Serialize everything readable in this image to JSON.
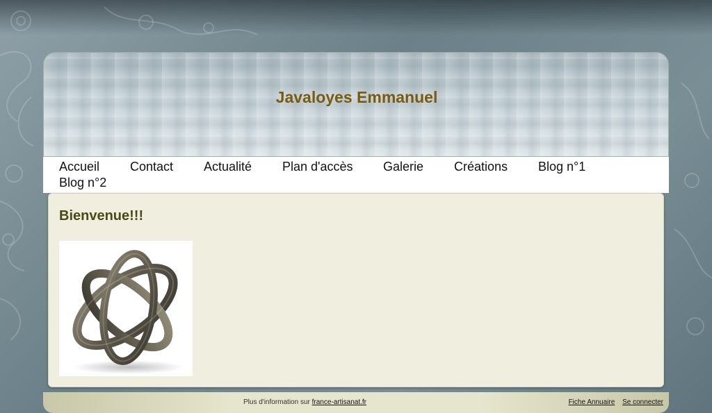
{
  "site": {
    "title": "Javaloyes Emmanuel"
  },
  "nav": {
    "items": [
      {
        "label": "Accueil"
      },
      {
        "label": "Contact"
      },
      {
        "label": "Actualité"
      },
      {
        "label": "Plan d'accès"
      },
      {
        "label": "Galerie"
      },
      {
        "label": "Créations"
      },
      {
        "label": "Blog n°1"
      },
      {
        "label": "Blog n°2"
      }
    ]
  },
  "main": {
    "heading": "Bienvenue!!!",
    "image": {
      "alt": "sculpture métallique entrelacée",
      "icon": "metal-ring-sculpture"
    }
  },
  "footer": {
    "info_prefix": "Plus d'information sur",
    "info_link": "france-artisanat.fr",
    "directory_link": "Fiche Annuaire",
    "login_link": "Se connecter"
  },
  "colors": {
    "title": "#7a5a0e",
    "heading": "#4a4a16",
    "content_bg": "#efeedf",
    "footer_bg": "#e6e5cd"
  }
}
